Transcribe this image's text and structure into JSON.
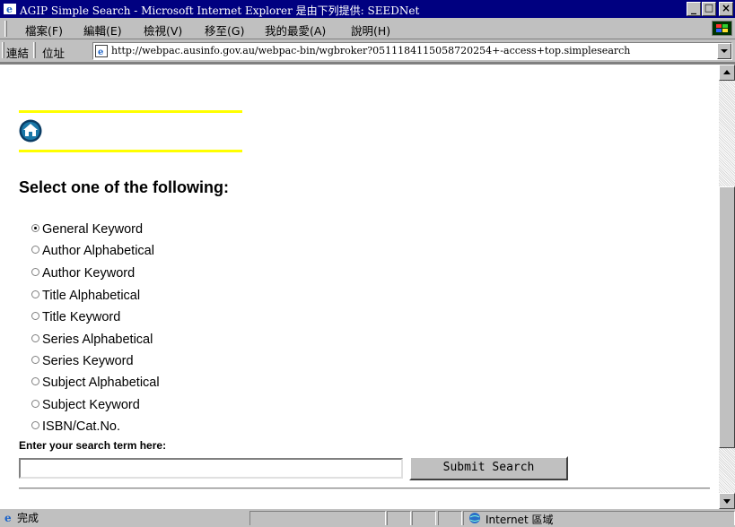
{
  "window": {
    "title": "AGIP Simple Search - Microsoft Internet Explorer 是由下列提供: SEEDNet",
    "minimize": "_",
    "maximize": "□",
    "close": "×"
  },
  "menu": {
    "items": [
      {
        "label": "檔案(F)"
      },
      {
        "label": "編輯(E)"
      },
      {
        "label": "檢視(V)"
      },
      {
        "label": "移至(G)"
      },
      {
        "label": "我的最愛(A)"
      },
      {
        "label": "說明(H)"
      }
    ]
  },
  "address_bar": {
    "links_label": "連結",
    "address_label": "位址",
    "url": "http://webpac.ausinfo.gov.au/webpac-bin/wgbroker?05111841150587202​54+-access+top.simplesearch"
  },
  "page": {
    "home_icon": "home-icon",
    "heading": "Select one of the following:",
    "options": [
      {
        "label": "General Keyword",
        "checked": true
      },
      {
        "label": "Author Alphabetical",
        "checked": false
      },
      {
        "label": "Author Keyword",
        "checked": false
      },
      {
        "label": "Title Alphabetical",
        "checked": false
      },
      {
        "label": "Title Keyword",
        "checked": false
      },
      {
        "label": "Series Alphabetical",
        "checked": false
      },
      {
        "label": "Series Keyword",
        "checked": false
      },
      {
        "label": "Subject Alphabetical",
        "checked": false
      },
      {
        "label": "Subject Keyword",
        "checked": false
      },
      {
        "label": "ISBN/Cat.No.",
        "checked": false
      }
    ],
    "prompt": "Enter your search term here:",
    "search_value": "",
    "submit_label": "Submit Search"
  },
  "status": {
    "text": "完成",
    "zone": "Internet 區域"
  },
  "colors": {
    "title_bar": "#000080",
    "rule": "#ffff00"
  }
}
